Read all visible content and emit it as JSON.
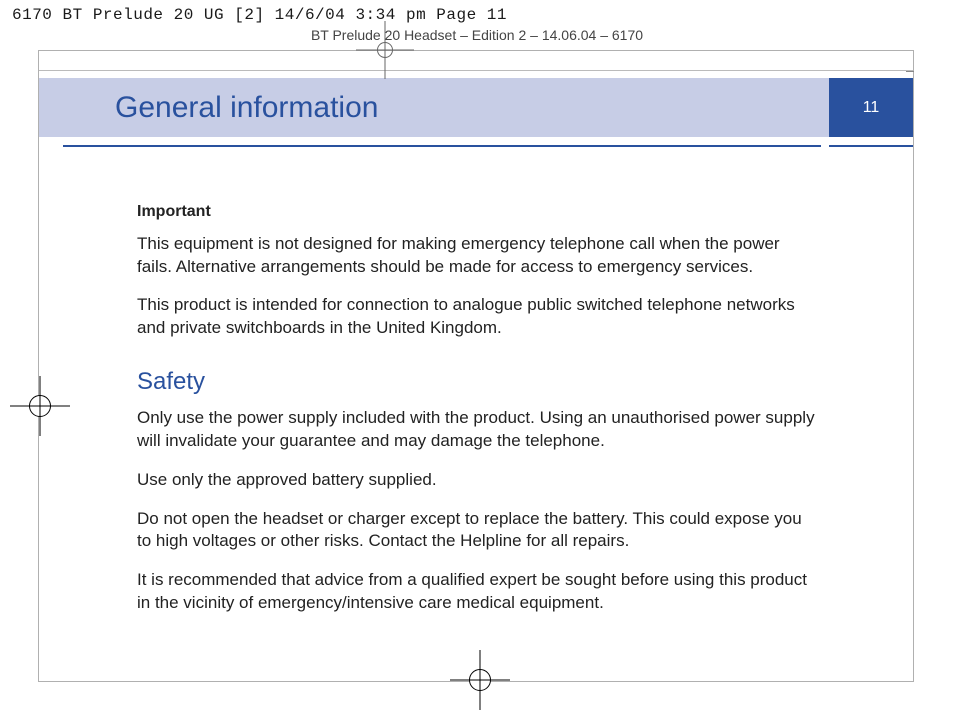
{
  "print_meta": "6170 BT Prelude 20 UG [2]  14/6/04  3:34 pm  Page 11",
  "doc_subtitle": "BT Prelude 20 Headset – Edition 2 – 14.06.04 – 6170",
  "banner": {
    "title": "General information",
    "page_number": "11"
  },
  "body": {
    "important_label": "Important",
    "important_p1": "This equipment is not designed for making emergency telephone call when the power fails. Alternative arrangements should be made for access to emergency services.",
    "important_p2": "This product is intended for connection to analogue public switched telephone networks and private switchboards in the United Kingdom.",
    "safety_heading": "Safety",
    "safety_p1": "Only use the power supply included with the product. Using an unauthorised power supply will invalidate your guarantee and may damage the telephone.",
    "safety_p2": "Use only the approved battery supplied.",
    "safety_p3": "Do not open the headset or charger except to replace the battery. This could expose you to high voltages or other risks. Contact the Helpline for all repairs.",
    "safety_p4": "It is recommended that advice from a qualified expert be sought before using this product in the vicinity of emergency/intensive care medical equipment."
  }
}
